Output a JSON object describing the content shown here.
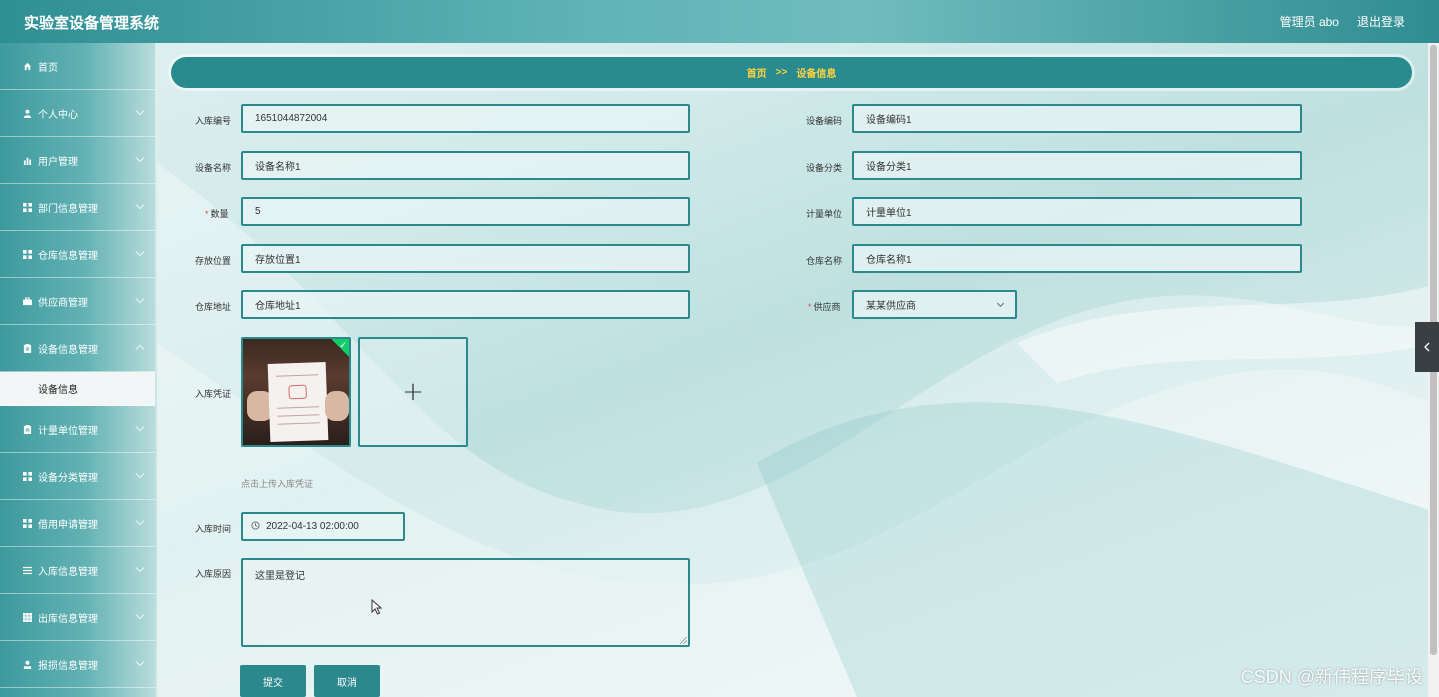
{
  "header": {
    "app_title": "实验室设备管理系统",
    "user_label": "管理员 abo",
    "logout_label": "退出登录"
  },
  "sidebar": {
    "items": [
      {
        "label": "首页",
        "icon": "home-icon"
      },
      {
        "label": "个人中心",
        "icon": "user-icon"
      },
      {
        "label": "用户管理",
        "icon": "bar-chart-icon"
      },
      {
        "label": "部门信息管理",
        "icon": "grid-icon"
      },
      {
        "label": "仓库信息管理",
        "icon": "grid-icon"
      },
      {
        "label": "供应商管理",
        "icon": "briefcase-icon"
      },
      {
        "label": "设备信息管理",
        "icon": "clipboard-icon"
      },
      {
        "label": "计量单位管理",
        "icon": "clipboard-icon"
      },
      {
        "label": "设备分类管理",
        "icon": "grid-icon"
      },
      {
        "label": "借用申请管理",
        "icon": "grid-icon"
      },
      {
        "label": "入库信息管理",
        "icon": "list-icon"
      },
      {
        "label": "出库信息管理",
        "icon": "table-icon"
      },
      {
        "label": "报损信息管理",
        "icon": "person-icon"
      }
    ],
    "active_sub": "设备信息"
  },
  "breadcrumb": {
    "home": "首页",
    "separator": ">>",
    "current": "设备信息"
  },
  "form": {
    "in_no": {
      "label": "入库编号",
      "value": "1651044872004"
    },
    "device_code": {
      "label": "设备编码",
      "value": "设备编码1"
    },
    "device_name": {
      "label": "设备名称",
      "value": "设备名称1"
    },
    "device_category": {
      "label": "设备分类",
      "value": "设备分类1"
    },
    "quantity": {
      "label": "数量",
      "required_mark": "*",
      "value": "5"
    },
    "unit": {
      "label": "计量单位",
      "value": "计量单位1"
    },
    "location": {
      "label": "存放位置",
      "value": "存放位置1"
    },
    "warehouse_name": {
      "label": "仓库名称",
      "value": "仓库名称1"
    },
    "warehouse_addr": {
      "label": "仓库地址",
      "value": "仓库地址1"
    },
    "supplier": {
      "label": "供应商",
      "required_mark": "*",
      "value": "某某供应商"
    },
    "voucher": {
      "label": "入库凭证",
      "hint": "点击上传入库凭证",
      "add_symbol": "+"
    },
    "in_time": {
      "label": "入库时间",
      "value": "2022-04-13 02:00:00"
    },
    "reason": {
      "label": "入库原因",
      "value": "这里是登记"
    }
  },
  "buttons": {
    "submit": "提交",
    "cancel": "取消"
  },
  "watermark": "CSDN @新伟程序毕设",
  "colors": {
    "primary": "#2b898d",
    "breadcrumb_text": "#ffd23f",
    "required": "#e04b4b"
  }
}
